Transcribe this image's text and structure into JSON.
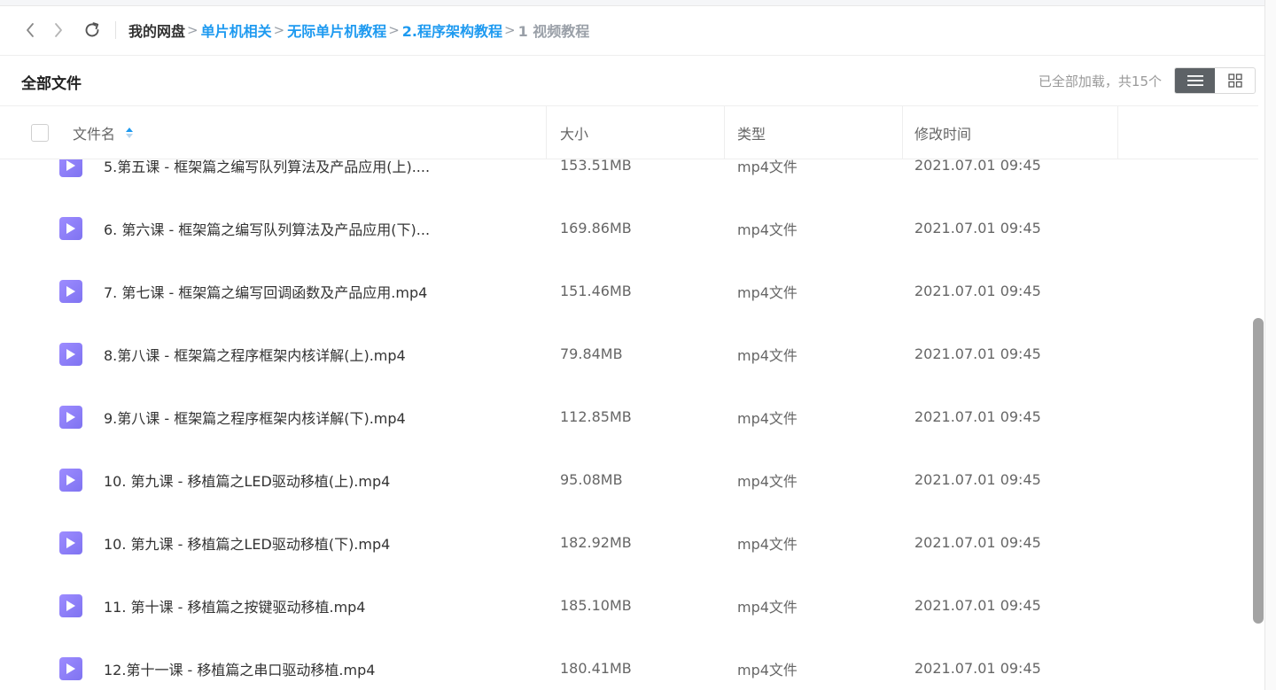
{
  "breadcrumb": {
    "home": "我的网盘",
    "items": [
      "单片机相关",
      "无际单片机教程",
      "2.程序架构教程"
    ],
    "current": "1 视频教程",
    "separator": ">"
  },
  "section": {
    "title": "全部文件",
    "status": "已全部加载，共15个"
  },
  "view_toggle": {
    "list_icon": "list-icon",
    "grid_icon": "grid-icon",
    "active": "list"
  },
  "columns": {
    "name": "文件名",
    "size": "大小",
    "type": "类型",
    "modified": "修改时间"
  },
  "files": [
    {
      "name": "5.第五课 - 框架篇之编写队列算法及产品应用(上)....",
      "size": "153.51MB",
      "type": "mp4文件",
      "modified": "2021.07.01 09:45"
    },
    {
      "name": "6. 第六课 - 框架篇之编写队列算法及产品应用(下)...",
      "size": "169.86MB",
      "type": "mp4文件",
      "modified": "2021.07.01 09:45"
    },
    {
      "name": "7. 第七课 - 框架篇之编写回调函数及产品应用.mp4",
      "size": "151.46MB",
      "type": "mp4文件",
      "modified": "2021.07.01 09:45"
    },
    {
      "name": "8.第八课 - 框架篇之程序框架内核详解(上).mp4",
      "size": "79.84MB",
      "type": "mp4文件",
      "modified": "2021.07.01 09:45"
    },
    {
      "name": "9.第八课 - 框架篇之程序框架内核详解(下).mp4",
      "size": "112.85MB",
      "type": "mp4文件",
      "modified": "2021.07.01 09:45"
    },
    {
      "name": "10. 第九课 - 移植篇之LED驱动移植(上).mp4",
      "size": "95.08MB",
      "type": "mp4文件",
      "modified": "2021.07.01 09:45"
    },
    {
      "name": "10. 第九课 - 移植篇之LED驱动移植(下).mp4",
      "size": "182.92MB",
      "type": "mp4文件",
      "modified": "2021.07.01 09:45"
    },
    {
      "name": "11. 第十课 - 移植篇之按键驱动移植.mp4",
      "size": "185.10MB",
      "type": "mp4文件",
      "modified": "2021.07.01 09:45"
    },
    {
      "name": "12.第十一课 - 移植篇之串口驱动移植.mp4",
      "size": "180.41MB",
      "type": "mp4文件",
      "modified": "2021.07.01 09:45"
    }
  ],
  "colors": {
    "link": "#1e9af0",
    "file_icon": "#8a7df5",
    "active_view": "#5d6266"
  }
}
